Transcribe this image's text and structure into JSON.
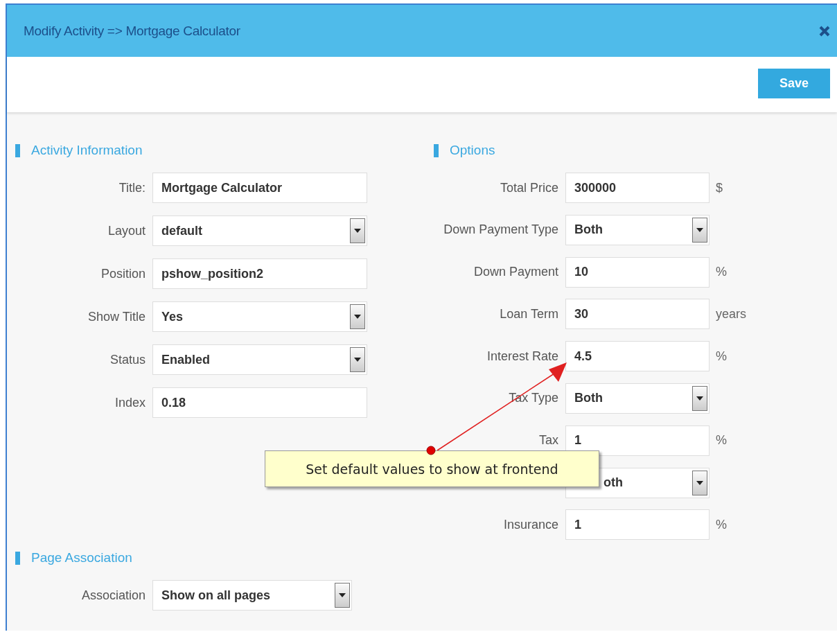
{
  "dialog": {
    "title": "Modify Activity => Mortgage Calculator",
    "save_button": "Save"
  },
  "columns": [
    {
      "sections": [
        {
          "title": "Activity Information",
          "rows": [
            {
              "label": "Title:",
              "kind": "text",
              "value": "Mortgage Calculator"
            },
            {
              "label": "Layout",
              "kind": "select",
              "value": "default"
            },
            {
              "label": "Position",
              "kind": "text",
              "value": "pshow_position2"
            },
            {
              "label": "Show Title",
              "kind": "select",
              "value": "Yes"
            },
            {
              "label": "Status",
              "kind": "select",
              "value": "Enabled"
            },
            {
              "label": "Index",
              "kind": "text",
              "value": "0.18"
            }
          ]
        }
      ]
    },
    {
      "sections": [
        {
          "title": "Options",
          "rows": [
            {
              "label": "Total Price",
              "kind": "text",
              "value": "300000",
              "unit": "$"
            },
            {
              "label": "Down Payment Type",
              "kind": "select",
              "value": "Both"
            },
            {
              "label": "Down Payment",
              "kind": "text",
              "value": "10",
              "unit": "%"
            },
            {
              "label": "Loan Term",
              "kind": "text",
              "value": "30",
              "unit": "years"
            },
            {
              "label": "Interest Rate",
              "kind": "text",
              "value": "4.5",
              "unit": "%"
            },
            {
              "label": "Tax Type",
              "kind": "select",
              "value": "Both"
            },
            {
              "label": "Tax",
              "kind": "text",
              "value": "1",
              "unit": "%"
            },
            {
              "kind": "select",
              "value": "oth"
            },
            {
              "label": "Insurance",
              "kind": "text",
              "value": "1",
              "unit": "%"
            }
          ]
        }
      ]
    }
  ],
  "page_association": {
    "title": "Page Association",
    "rows": [
      {
        "label": "Association",
        "kind": "select",
        "value": "Show on all pages"
      }
    ]
  },
  "callout": {
    "text": "Set default values to show at frontend"
  }
}
